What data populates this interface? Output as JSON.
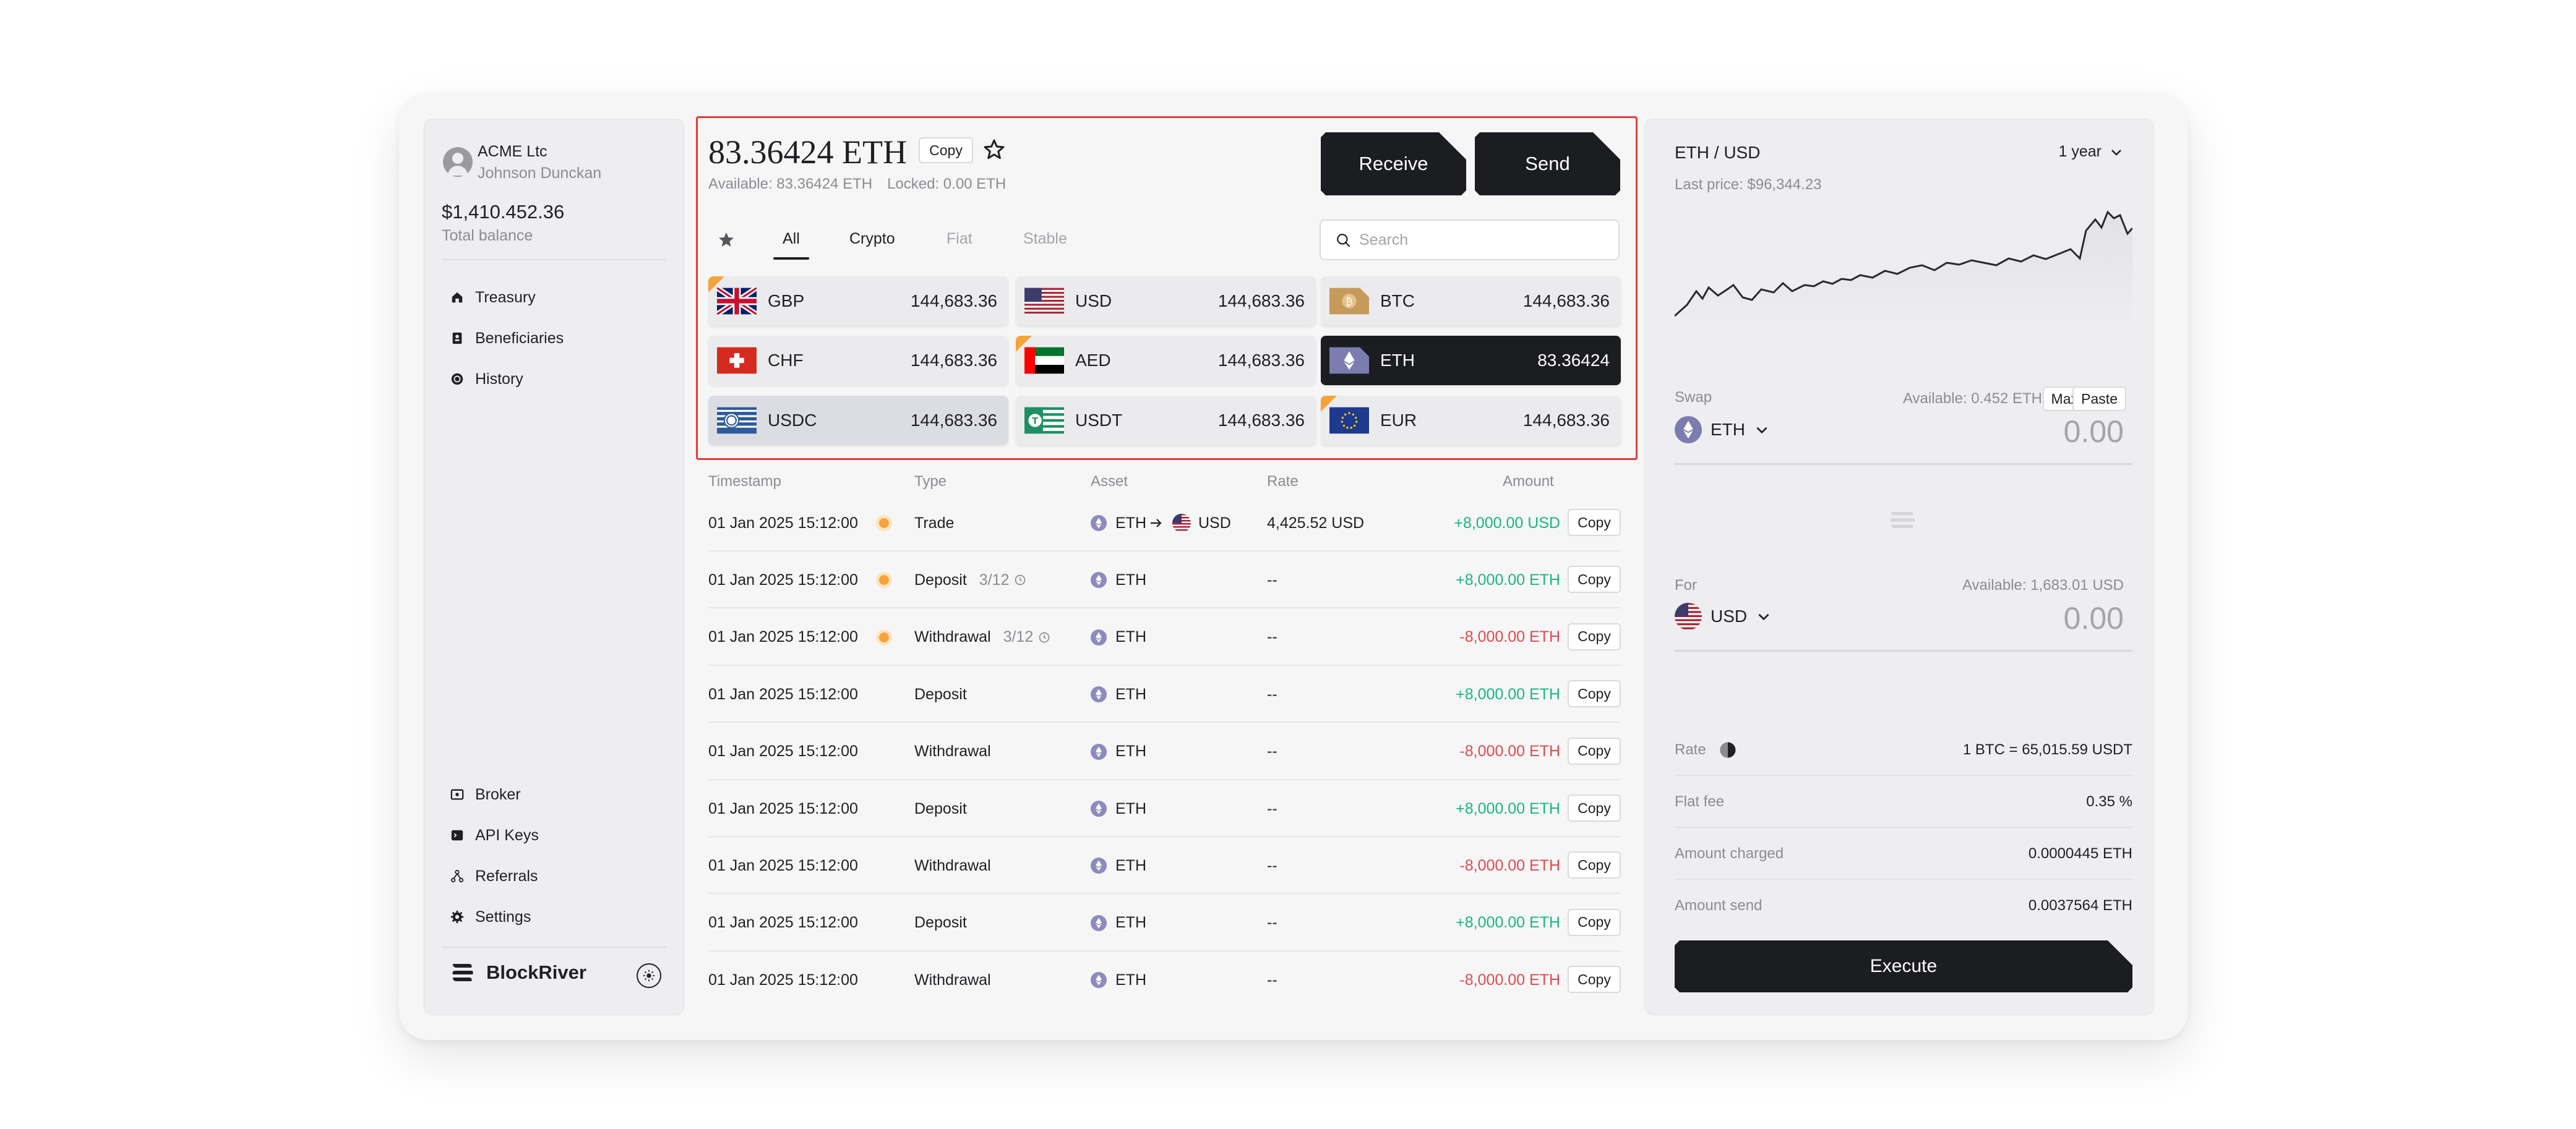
{
  "sidebar": {
    "company": "ACME Ltc",
    "user": "Johnson Dunckan",
    "balance": "$1,410.452.36",
    "balance_label": "Total balance",
    "nav_top": [
      {
        "label": "Treasury",
        "icon": "home-icon"
      },
      {
        "label": "Beneficiaries",
        "icon": "contact-book-icon"
      },
      {
        "label": "History",
        "icon": "history-icon"
      }
    ],
    "nav_bottom": [
      {
        "label": "Broker",
        "icon": "broker-icon"
      },
      {
        "label": "API Keys",
        "icon": "terminal-icon"
      },
      {
        "label": "Referrals",
        "icon": "network-icon"
      },
      {
        "label": "Settings",
        "icon": "gear-icon"
      }
    ],
    "brand": "BlockRiver"
  },
  "header": {
    "amount": "83.36424 ETH",
    "copy_label": "Copy",
    "available": "Available: 83.36424 ETH",
    "locked": "Locked: 0.00 ETH",
    "receive_label": "Receive",
    "send_label": "Send"
  },
  "filters": {
    "tabs": [
      "All",
      "Crypto",
      "Fiat",
      "Stable"
    ],
    "active": "All",
    "search_placeholder": "Search"
  },
  "assets": [
    {
      "code": "GBP",
      "value": "144,683.36"
    },
    {
      "code": "USD",
      "value": "144,683.36"
    },
    {
      "code": "BTC",
      "value": "144,683.36"
    },
    {
      "code": "CHF",
      "value": "144,683.36"
    },
    {
      "code": "AED",
      "value": "144,683.36"
    },
    {
      "code": "ETH",
      "value": "83.36424"
    },
    {
      "code": "USDC",
      "value": "144,683.36"
    },
    {
      "code": "USDT",
      "value": "144,683.36"
    },
    {
      "code": "EUR",
      "value": "144,683.36"
    }
  ],
  "table": {
    "headers": {
      "timestamp": "Timestamp",
      "type": "Type",
      "asset": "Asset",
      "rate": "Rate",
      "amount": "Amount"
    },
    "copy_label": "Copy",
    "rows": [
      {
        "timestamp": "01 Jan 2025 15:12:00",
        "type": "Trade",
        "progress": "",
        "asset": "ETH",
        "asset_to": "USD",
        "rate": "4,425.52 USD",
        "amount": "+8,000.00 USD",
        "sign": "pos",
        "pending": true
      },
      {
        "timestamp": "01 Jan 2025 15:12:00",
        "type": "Deposit",
        "progress": "3/12",
        "asset": "ETH",
        "asset_to": "",
        "rate": "--",
        "amount": "+8,000.00 ETH",
        "sign": "pos",
        "pending": true
      },
      {
        "timestamp": "01 Jan 2025 15:12:00",
        "type": "Withdrawal",
        "progress": "3/12",
        "asset": "ETH",
        "asset_to": "",
        "rate": "--",
        "amount": "-8,000.00 ETH",
        "sign": "neg",
        "pending": true
      },
      {
        "timestamp": "01 Jan 2025 15:12:00",
        "type": "Deposit",
        "progress": "",
        "asset": "ETH",
        "asset_to": "",
        "rate": "--",
        "amount": "+8,000.00 ETH",
        "sign": "pos",
        "pending": false
      },
      {
        "timestamp": "01 Jan 2025 15:12:00",
        "type": "Withdrawal",
        "progress": "",
        "asset": "ETH",
        "asset_to": "",
        "rate": "--",
        "amount": "-8,000.00 ETH",
        "sign": "neg",
        "pending": false
      },
      {
        "timestamp": "01 Jan 2025 15:12:00",
        "type": "Deposit",
        "progress": "",
        "asset": "ETH",
        "asset_to": "",
        "rate": "--",
        "amount": "+8,000.00 ETH",
        "sign": "pos",
        "pending": false
      },
      {
        "timestamp": "01 Jan 2025 15:12:00",
        "type": "Withdrawal",
        "progress": "",
        "asset": "ETH",
        "asset_to": "",
        "rate": "--",
        "amount": "-8,000.00 ETH",
        "sign": "neg",
        "pending": false
      },
      {
        "timestamp": "01 Jan 2025 15:12:00",
        "type": "Deposit",
        "progress": "",
        "asset": "ETH",
        "asset_to": "",
        "rate": "--",
        "amount": "+8,000.00 ETH",
        "sign": "pos",
        "pending": false
      },
      {
        "timestamp": "01 Jan 2025 15:12:00",
        "type": "Withdrawal",
        "progress": "",
        "asset": "ETH",
        "asset_to": "",
        "rate": "--",
        "amount": "-8,000.00 ETH",
        "sign": "neg",
        "pending": false
      }
    ]
  },
  "swap_panel": {
    "pair": "ETH / USD",
    "period": "1 year",
    "last_price_label": "Last price:",
    "last_price": "$96,344.23",
    "swap_label": "Swap",
    "swap_available": "Available: 0.452 ETH",
    "max_label": "Max",
    "paste_label": "Paste",
    "swap_currency": "ETH",
    "swap_value": "0.00",
    "for_label": "For",
    "for_available": "Available: 1,683.01 USD",
    "for_currency": "USD",
    "for_value": "0.00",
    "info": [
      {
        "key": "Rate",
        "value": "1 BTC = 65,015.59 USDT"
      },
      {
        "key": "Flat fee",
        "value": "0.35 %"
      },
      {
        "key": "Amount charged",
        "value": "0.0000445 ETH"
      },
      {
        "key": "Amount send",
        "value": "0.0037564 ETH"
      }
    ],
    "execute_label": "Execute"
  },
  "colors": {
    "accent_dark": "#1c1d20",
    "positive": "#17b77f",
    "negative": "#e5484d",
    "pending": "#f6a33a"
  }
}
